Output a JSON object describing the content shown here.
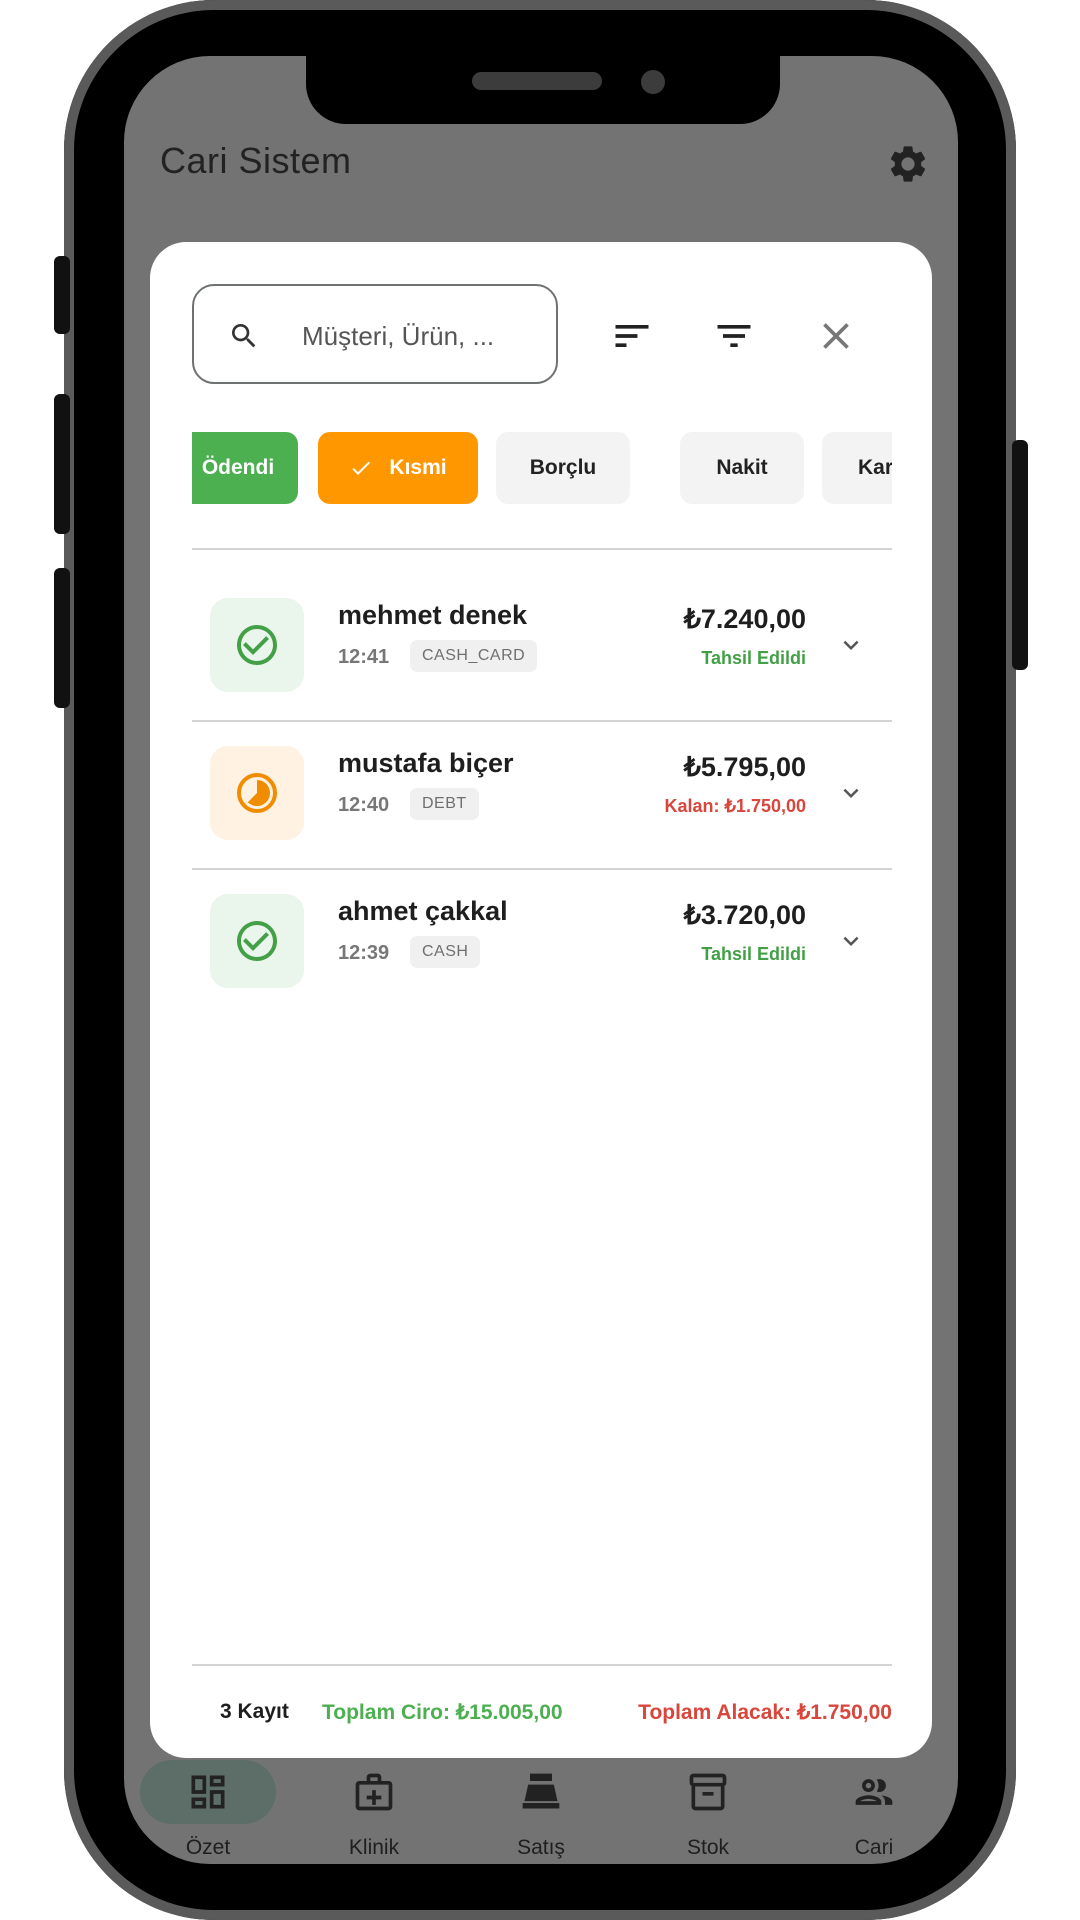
{
  "app": {
    "title": "Cari Sistem",
    "icons": {
      "settings": "gear-icon"
    }
  },
  "search": {
    "placeholder": "Müşteri, Ürün, ..."
  },
  "toolbar": {
    "icons": [
      "sort-icon",
      "filter-icon",
      "close-icon"
    ]
  },
  "filters": [
    {
      "label": "Ödendi",
      "style": "green",
      "selected": false
    },
    {
      "label": "Kısmi",
      "style": "orange",
      "selected": true
    },
    {
      "label": "Borçlu",
      "style": "grey",
      "selected": false
    },
    {
      "label": "Nakit",
      "style": "grey",
      "selected": false
    },
    {
      "label": "Kart",
      "style": "grey",
      "selected": false
    }
  ],
  "transactions": [
    {
      "name": "mehmet denek",
      "time": "12:41",
      "method": "CASH_CARD",
      "amount": "₺7.240,00",
      "status_text": "Tahsil Edildi",
      "status": "paid",
      "status_color": "#43a047"
    },
    {
      "name": "mustafa biçer",
      "time": "12:40",
      "method": "DEBT",
      "amount": "₺5.795,00",
      "status_text": "Kalan: ₺1.750,00",
      "status": "partial",
      "status_color": "#d9463c"
    },
    {
      "name": "ahmet çakkal",
      "time": "12:39",
      "method": "CASH",
      "amount": "₺3.720,00",
      "status_text": "Tahsil Edildi",
      "status": "paid",
      "status_color": "#43a047"
    }
  ],
  "summary": {
    "count": "3 Kayıt",
    "total_revenue": "Toplam Ciro: ₺15.005,00",
    "total_receivable": "Toplam Alacak: ₺1.750,00"
  },
  "bottom_nav": [
    {
      "label": "Özet",
      "icon": "dashboard-icon",
      "active": true
    },
    {
      "label": "Klinik",
      "icon": "medical-bag-icon",
      "active": false
    },
    {
      "label": "Satış",
      "icon": "cash-register-icon",
      "active": false
    },
    {
      "label": "Stok",
      "icon": "archive-box-icon",
      "active": false
    },
    {
      "label": "Cari",
      "icon": "people-icon",
      "active": false
    }
  ],
  "colors": {
    "accent_green": "#4caf50",
    "accent_orange": "#ff9800",
    "error_red": "#d9463c",
    "scrim": "#727372"
  }
}
